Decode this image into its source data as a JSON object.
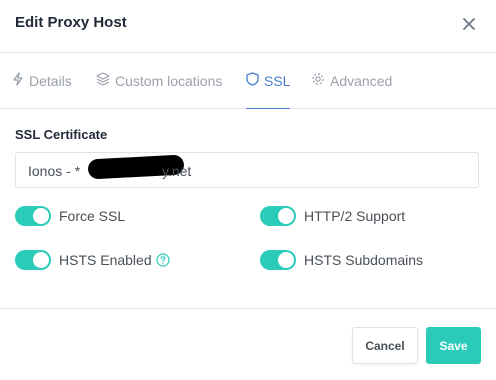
{
  "modal": {
    "title": "Edit Proxy Host",
    "close_icon": "close-icon"
  },
  "tabs": [
    {
      "label": "Details",
      "icon": "bolt-icon",
      "active": false
    },
    {
      "label": "Custom locations",
      "icon": "layers-icon",
      "active": false
    },
    {
      "label": "SSL",
      "icon": "shield-icon",
      "active": true
    },
    {
      "label": "Advanced",
      "icon": "gear-icon",
      "active": false
    }
  ],
  "ssl": {
    "certificate_label": "SSL Certificate",
    "certificate_value_prefix": "Ionos - *",
    "certificate_value_suffix": "y.net",
    "toggles": [
      {
        "label": "Force SSL",
        "on": true
      },
      {
        "label": "HTTP/2 Support",
        "on": true
      },
      {
        "label": "HSTS Enabled",
        "on": true,
        "help_icon": "question-circle-icon"
      },
      {
        "label": "HSTS Subdomains",
        "on": true
      }
    ]
  },
  "footer": {
    "cancel_label": "Cancel",
    "save_label": "Save"
  },
  "colors": {
    "accent": "#2bcbba",
    "active_tab": "#467fcf",
    "muted": "#9aa0ac"
  }
}
